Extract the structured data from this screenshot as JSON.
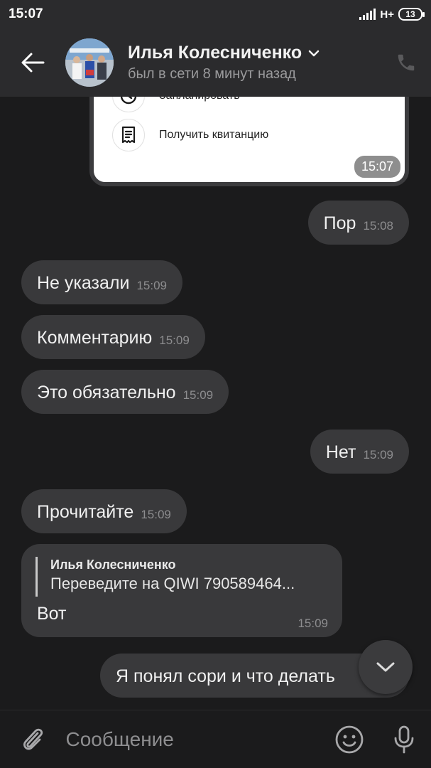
{
  "status_bar": {
    "time": "15:07",
    "network": "H+",
    "battery": "13"
  },
  "header": {
    "contact_name": "Илья Колесниченко",
    "last_seen": "был в сети 8 минут назад"
  },
  "card": {
    "items": [
      {
        "icon": "clock-icon",
        "label": "Запланировать"
      },
      {
        "icon": "receipt-icon",
        "label": "Получить квитанцию"
      }
    ],
    "time": "15:07"
  },
  "messages": [
    {
      "direction": "outgoing",
      "text": "Пор",
      "time": "15:08"
    },
    {
      "direction": "incoming",
      "text": "Не указали",
      "time": "15:09"
    },
    {
      "direction": "incoming",
      "text": "Комментарию",
      "time": "15:09"
    },
    {
      "direction": "incoming",
      "text": "Это обязательно",
      "time": "15:09"
    },
    {
      "direction": "outgoing",
      "text": "Нет",
      "time": "15:09"
    },
    {
      "direction": "incoming",
      "text": "Прочитайте",
      "time": "15:09"
    }
  ],
  "reply_message": {
    "quoted_author": "Илья Колесниченко",
    "quoted_text": "Переведите на QIWI 790589464...",
    "text": "Вот",
    "time": "15:09"
  },
  "last_message": {
    "text": "Я понял сори и что делать"
  },
  "composer": {
    "placeholder": "Сообщение"
  },
  "colors": {
    "background": "#1b1b1c",
    "bar": "#2b2b2d",
    "bubble": "#39393b",
    "card": "#ffffff"
  }
}
